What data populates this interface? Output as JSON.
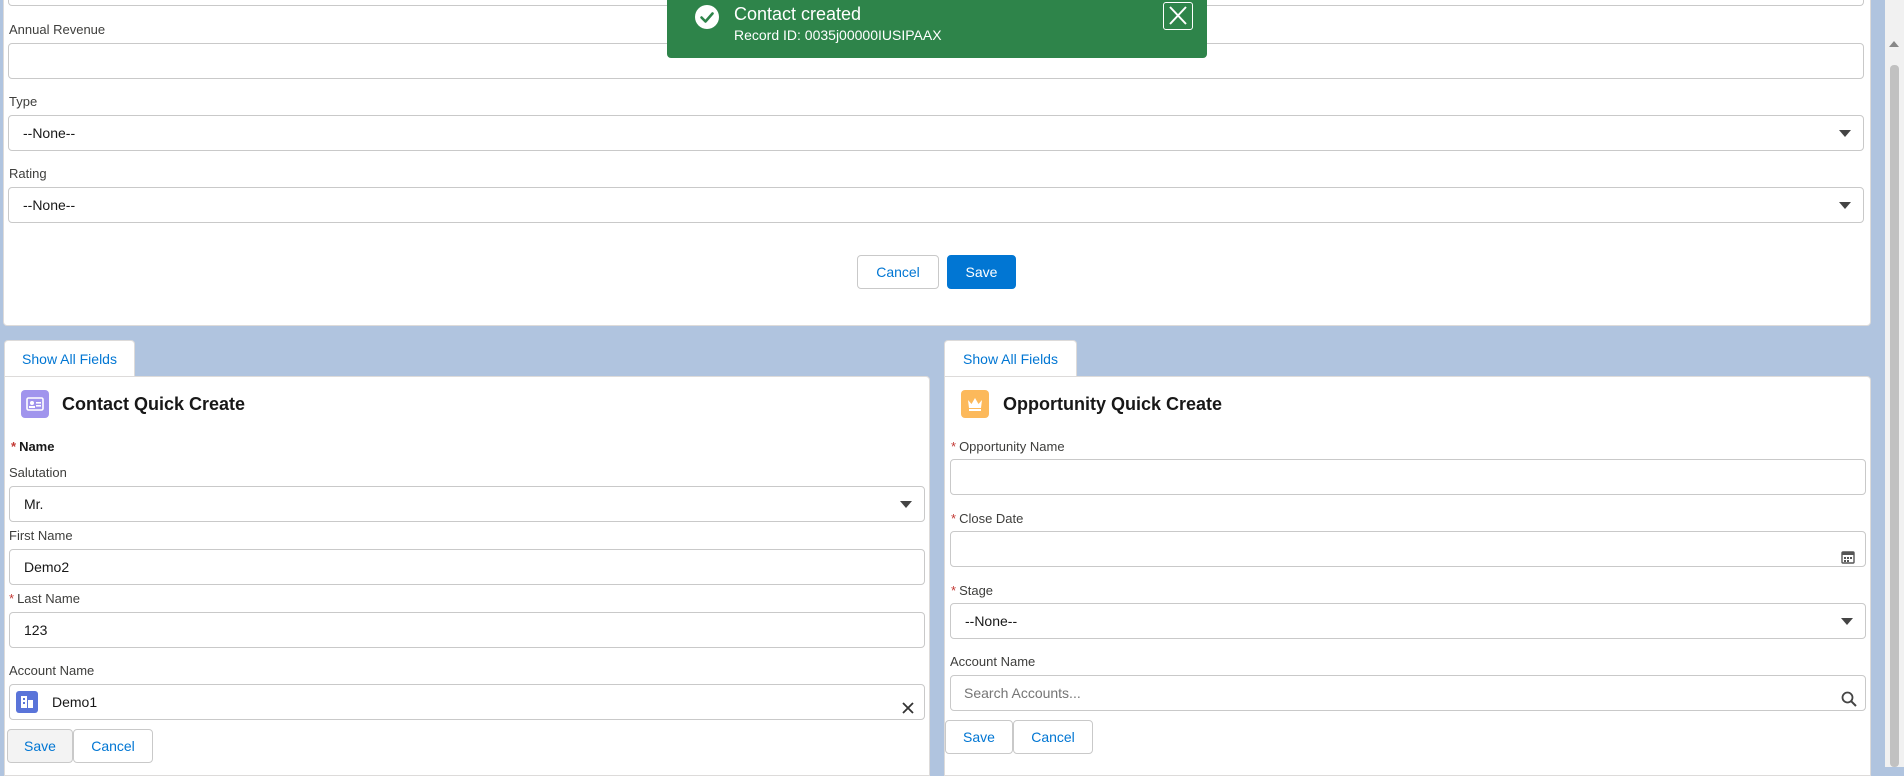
{
  "toast": {
    "title": "Contact created",
    "message": "Record ID: 0035j00000IUSIPAAX",
    "close_icon": "close-icon",
    "success_icon": "success-check-icon",
    "color": "#2e844a"
  },
  "account_form": {
    "annual_revenue_label": "Annual Revenue",
    "annual_revenue_value": "",
    "type_label": "Type",
    "type_value": "--None--",
    "rating_label": "Rating",
    "rating_value": "--None--",
    "cancel_label": "Cancel",
    "save_label": "Save"
  },
  "contact_card": {
    "show_all_label": "Show All Fields",
    "title": "Contact Quick Create",
    "icon": "contact-card-icon",
    "icon_color": "#a094ed",
    "name_label": "Name",
    "salutation_label": "Salutation",
    "salutation_value": "Mr.",
    "first_name_label": "First Name",
    "first_name_value": "Demo2",
    "last_name_label": "Last Name",
    "last_name_value": "123",
    "account_name_label": "Account Name",
    "account_name_value": "Demo1",
    "save_label": "Save",
    "cancel_label": "Cancel"
  },
  "opportunity_card": {
    "show_all_label": "Show All Fields",
    "title": "Opportunity Quick Create",
    "icon": "opportunity-crown-icon",
    "icon_color": "#fcb95b",
    "opp_name_label": "Opportunity Name",
    "opp_name_value": "",
    "close_date_label": "Close Date",
    "close_date_value": "",
    "stage_label": "Stage",
    "stage_value": "--None--",
    "account_name_label": "Account Name",
    "account_search_placeholder": "Search Accounts...",
    "save_label": "Save",
    "cancel_label": "Cancel"
  },
  "colors": {
    "background": "#b0c4df",
    "brand": "#0176d3"
  }
}
